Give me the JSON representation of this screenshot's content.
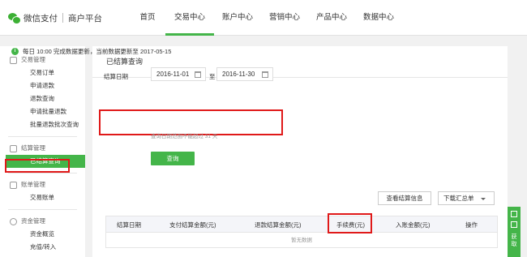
{
  "header": {
    "brand": "微信支付",
    "brand_sub": "商户平台",
    "nav": [
      "首页",
      "交易中心",
      "账户中心",
      "营销中心",
      "产品中心",
      "数据中心"
    ],
    "active_nav": "交易中心"
  },
  "sidebar": {
    "groups": [
      {
        "title": "交易管理",
        "items": [
          "交易订单",
          "申请退款",
          "退款查询",
          "申请批量退款",
          "批量退款批次查询"
        ]
      },
      {
        "title": "结算管理",
        "items": [
          "已结算查询"
        ]
      },
      {
        "title": "账单管理",
        "items": [
          "交易账单"
        ]
      },
      {
        "title": "资金管理",
        "items": [
          "资金概览",
          "充值/转入"
        ]
      }
    ],
    "active_item": "已结算查询"
  },
  "main": {
    "title": "已结算查询",
    "notice": "每日 10:00 完成数据更新，当前数据更新至 2017-05-15",
    "date_label": "结算日期",
    "date_from": "2016-11-01",
    "date_sep": "至",
    "date_to": "2016-11-30",
    "date_hint": "查询日期范围不能超过 31 天",
    "query_button": "查询",
    "view_info_button": "查看结算信息",
    "download_select": "下载汇总单",
    "table": {
      "columns": [
        "结算日期",
        "支付结算金额(元)",
        "退款结算金额(元)",
        "手续费(元)",
        "入账金额(元)",
        "操作"
      ],
      "empty_text": "暂无数据"
    }
  },
  "float": {
    "label": "获取"
  },
  "colors": {
    "accent": "#44b549",
    "highlight": "#e01919"
  }
}
